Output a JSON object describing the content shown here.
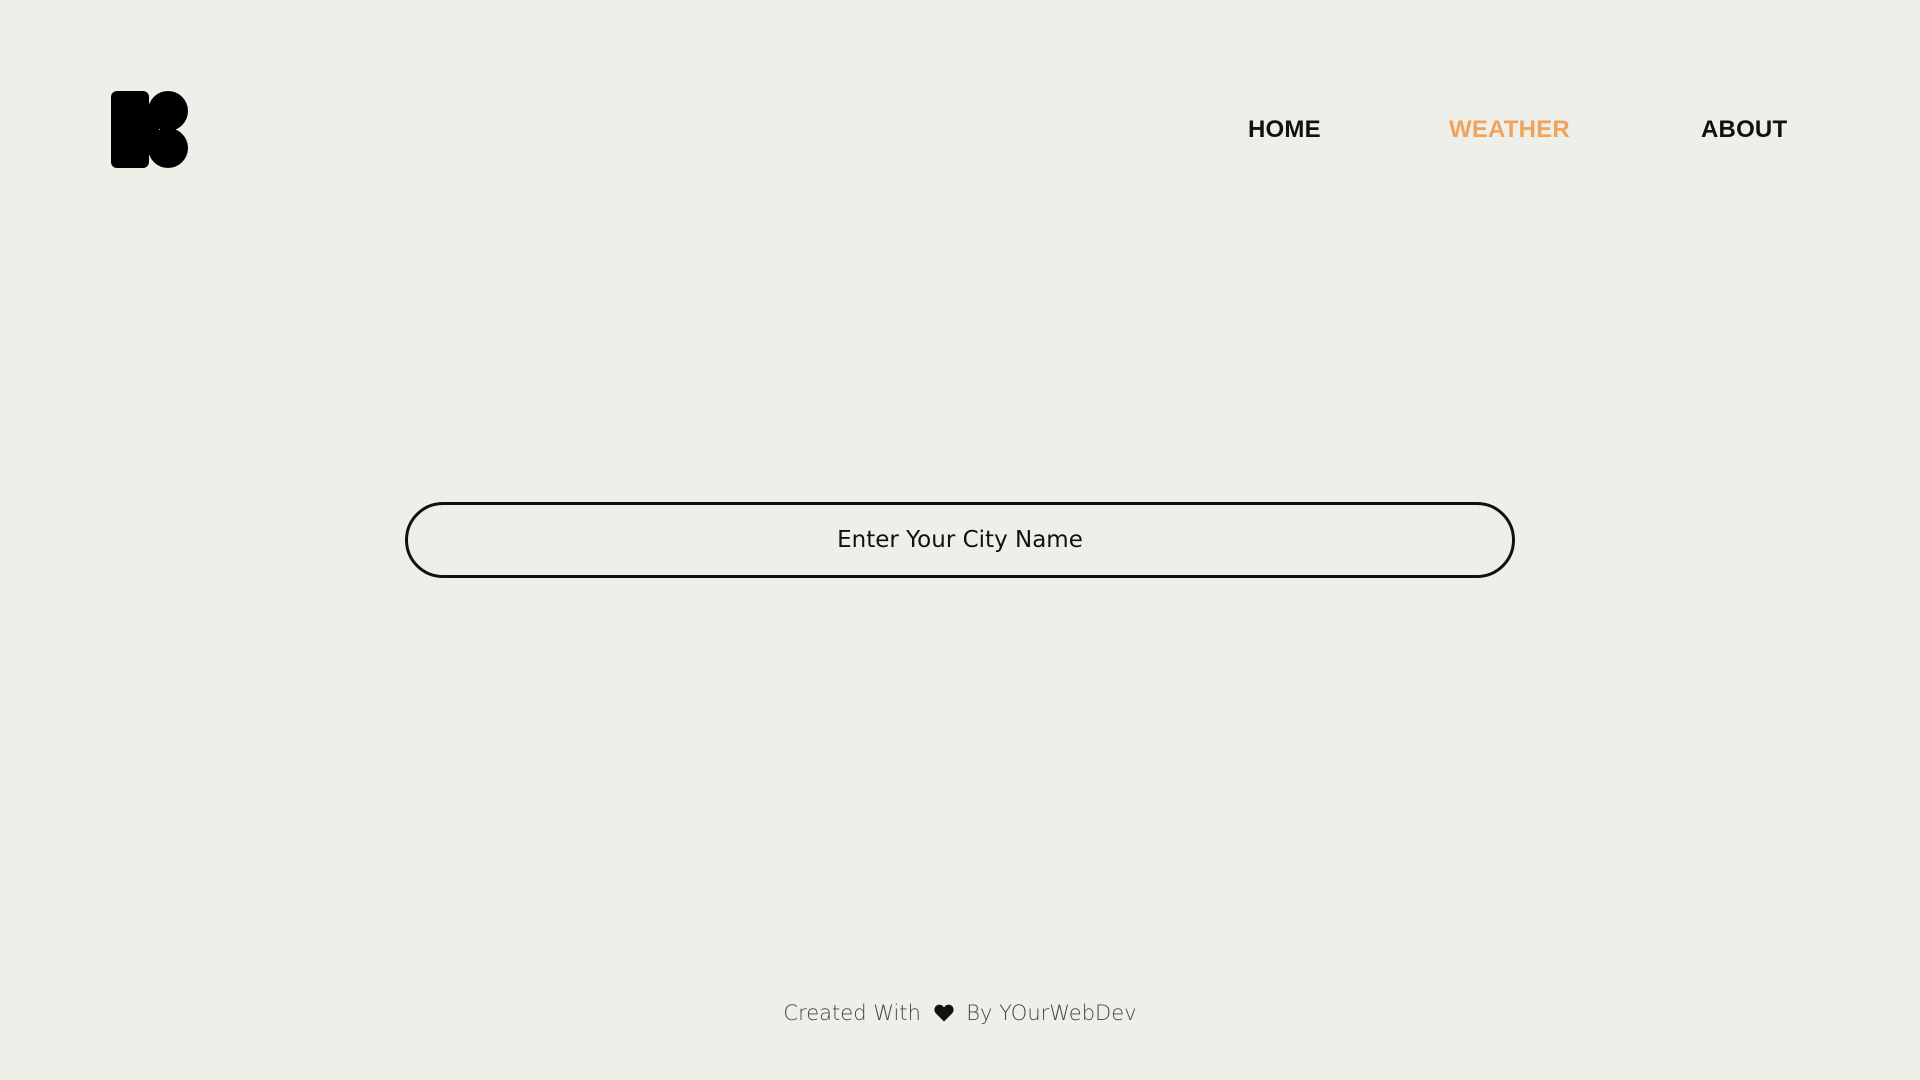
{
  "brand": {
    "logo_icon": "brand-logo-icon"
  },
  "nav": {
    "items": [
      {
        "label": "HOME",
        "active": false
      },
      {
        "label": "WEATHER",
        "active": true
      },
      {
        "label": "ABOUT",
        "active": false
      }
    ],
    "active_color": "#f0a35c"
  },
  "search": {
    "placeholder": "Enter Your City Name",
    "value": ""
  },
  "footer": {
    "prefix": "Created With",
    "icon": "heart-icon",
    "suffix": "By YOurWebDev"
  },
  "colors": {
    "background": "#efefea",
    "text": "#111111",
    "accent": "#f0a35c"
  }
}
